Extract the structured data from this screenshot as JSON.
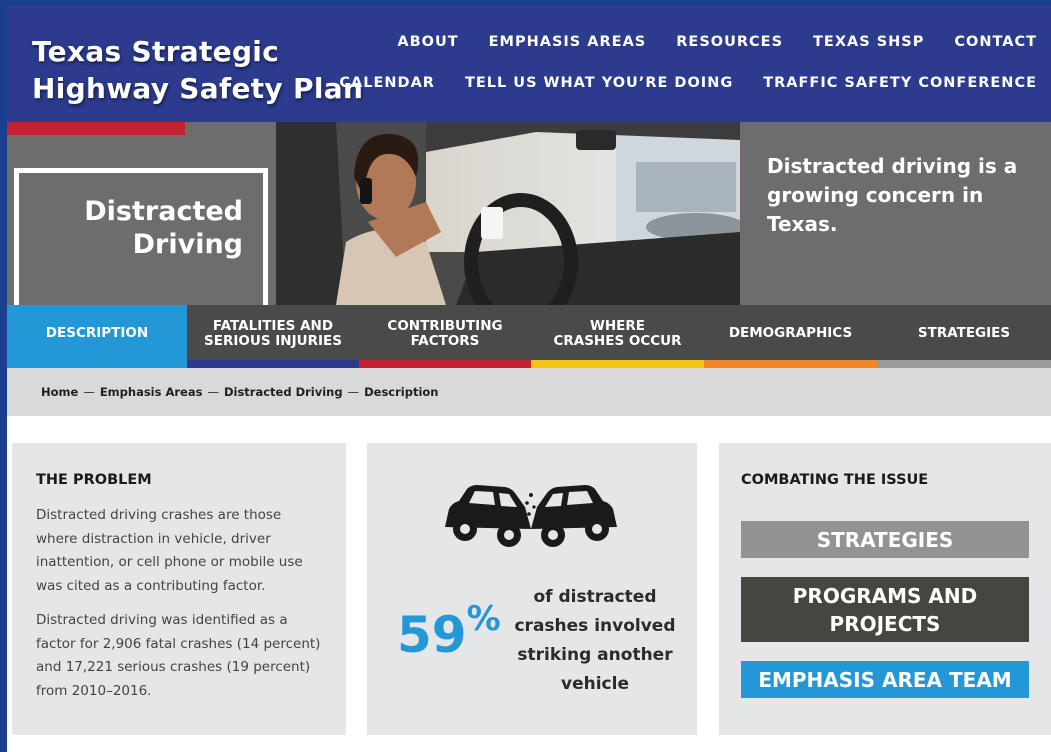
{
  "site": {
    "title_line1": "Texas Strategic",
    "title_line2": "Highway Safety Plan"
  },
  "nav": {
    "row1": [
      "ABOUT",
      "EMPHASIS AREAS",
      "RESOURCES",
      "TEXAS SHSP",
      "CONTACT"
    ],
    "row2": [
      "CALENDAR",
      "TELL US WHAT YOU’RE DOING",
      "TRAFFIC SAFETY CONFERENCE"
    ]
  },
  "hero": {
    "title_line1": "Distracted",
    "title_line2": "Driving",
    "tagline": "Distracted driving is a growing concern in Texas."
  },
  "tabs": [
    {
      "label": "DESCRIPTION",
      "active": true,
      "color": "#2497d6"
    },
    {
      "label": "FATALITIES AND SERIOUS INJURIES",
      "active": false,
      "color": "#2c3b8e"
    },
    {
      "label": "CONTRIBUTING FACTORS",
      "active": false,
      "color": "#c62035"
    },
    {
      "label": "WHERE CRASHES OCCUR",
      "active": false,
      "color": "#f3c316"
    },
    {
      "label": "DEMOGRAPHICS",
      "active": false,
      "color": "#f0852a"
    },
    {
      "label": "STRATEGIES",
      "active": false,
      "color": "#9a9a9a"
    }
  ],
  "breadcrumb": [
    "Home",
    "Emphasis Areas",
    "Distracted Driving",
    "Description"
  ],
  "problem": {
    "heading": "THE PROBLEM",
    "para1": "Distracted driving crashes are those where distraction in vehicle, driver inattention, or cell phone or mobile use was cited as a contributing factor.",
    "para2": "Distracted driving was identified as a factor for 2,906 fatal crashes (14 percent) and 17,221 serious crashes (19 percent) from 2010–2016."
  },
  "stat": {
    "value": "59",
    "unit": "%",
    "description": "of distracted crashes involved striking another vehicle",
    "icon": "car-crash-icon"
  },
  "combat": {
    "heading": "COMBATING THE ISSUE",
    "buttons": [
      "STRATEGIES",
      "PROGRAMS AND PROJECTS",
      "EMPHASIS AREA TEAM"
    ]
  },
  "colors": {
    "header": "#2c3b8e",
    "accent_blue": "#2497d6",
    "accent_red": "#c62035"
  }
}
